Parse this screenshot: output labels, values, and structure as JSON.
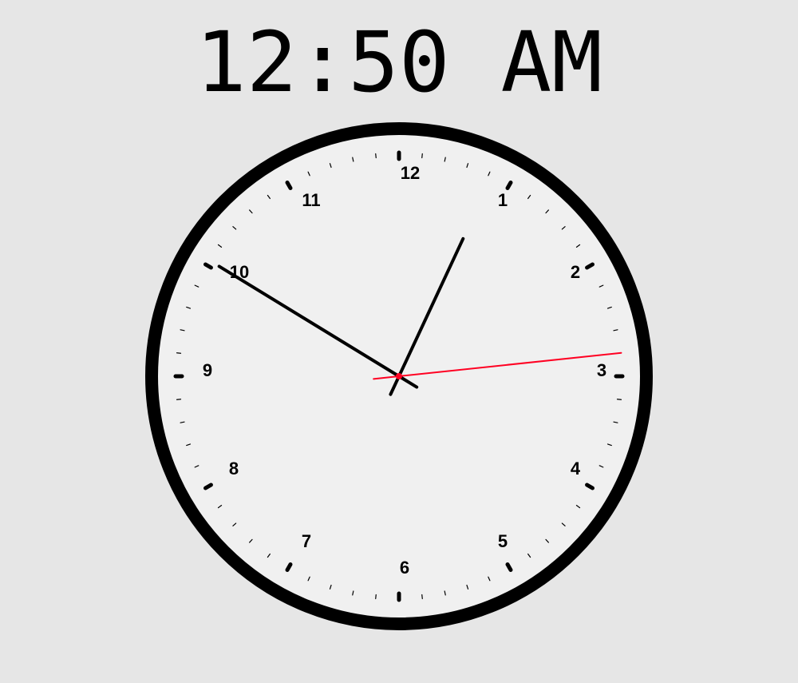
{
  "digital_time": "12:50 AM",
  "clock": {
    "numerals": [
      "12",
      "1",
      "2",
      "3",
      "4",
      "5",
      "6",
      "7",
      "8",
      "9",
      "10",
      "11"
    ],
    "time": {
      "hours": 12,
      "minutes": 50,
      "seconds": 14
    },
    "colors": {
      "background": "#e6e6e6",
      "face": "#f0f0f0",
      "rim": "#000000",
      "hands": "#000000",
      "second_hand": "#ff0022",
      "ticks": "#000000"
    }
  }
}
